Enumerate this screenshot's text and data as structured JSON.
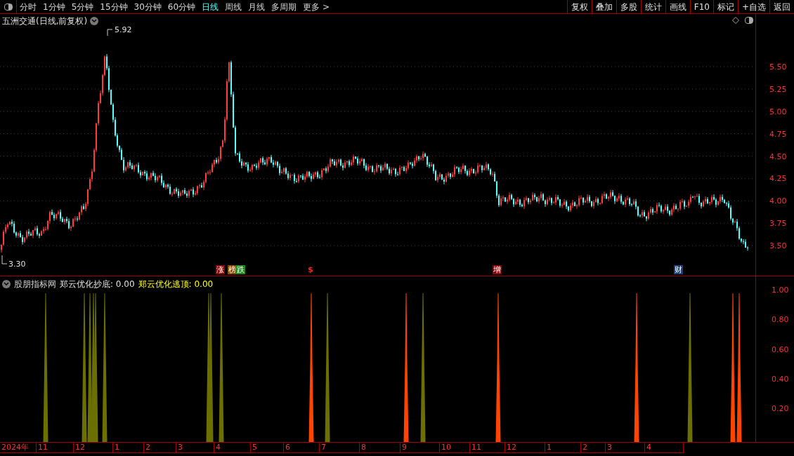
{
  "toolbar": {
    "periods": [
      {
        "label": "分时",
        "selected": false
      },
      {
        "label": "1分钟",
        "selected": false
      },
      {
        "label": "5分钟",
        "selected": false
      },
      {
        "label": "15分钟",
        "selected": false
      },
      {
        "label": "30分钟",
        "selected": false
      },
      {
        "label": "60分钟",
        "selected": false
      },
      {
        "label": "日线",
        "selected": true
      },
      {
        "label": "周线",
        "selected": false
      },
      {
        "label": "月线",
        "selected": false
      },
      {
        "label": "多周期",
        "selected": false
      },
      {
        "label": "更多 >",
        "selected": false
      }
    ],
    "buttons": [
      "复权",
      "叠加",
      "多股",
      "统计",
      "画线",
      "F10",
      "标记",
      "+自选",
      "返回"
    ]
  },
  "main_chart": {
    "title": "五洲交通(日线,前复权)",
    "high_label": "5.92",
    "low_label": "3.30",
    "y_axis": [
      "5.50",
      "5.25",
      "5.00",
      "4.75",
      "4.50",
      "4.25",
      "4.00",
      "3.75",
      "3.50"
    ],
    "markers": [
      {
        "text": "涨",
        "color": "#8b0000"
      },
      {
        "text": "榜",
        "color": "#8b4a00"
      },
      {
        "text": "跌",
        "color": "#1a8a1a"
      },
      {
        "text": "$",
        "color": "#000000"
      },
      {
        "text": "增",
        "color": "#8b0000"
      },
      {
        "text": "财",
        "color": "#1a3f7a"
      }
    ]
  },
  "indicator": {
    "name": "股朋指标网",
    "lines": [
      {
        "text": "郑云优化抄底: 0.00",
        "color": "#e0e0e0"
      },
      {
        "text": "郑云优化逃顶: 0.00",
        "color": "#ffff00"
      }
    ],
    "y_axis": [
      "1.00",
      "0.80",
      "0.60",
      "0.40",
      "0.20"
    ]
  },
  "time_axis": [
    "2024年",
    "11",
    "12",
    "1",
    "2",
    "3",
    "4",
    "5",
    "6",
    "7",
    "8",
    "9",
    "10",
    "11",
    "12",
    "1",
    "2",
    "3",
    "4"
  ]
}
